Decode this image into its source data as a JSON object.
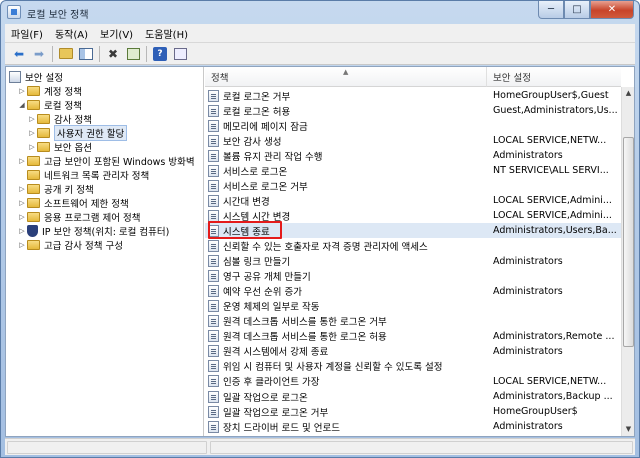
{
  "window": {
    "title": "로컬 보안 정책",
    "min_label": "─",
    "max_label": "□",
    "close_label": "✕"
  },
  "menu": [
    "파일(F)",
    "동작(A)",
    "보기(V)",
    "도움말(H)"
  ],
  "toolbar": {
    "back": "⬅",
    "forward": "➡",
    "delete": "✖",
    "help": "?"
  },
  "tree": {
    "root": "보안 설정",
    "items": [
      {
        "label": "계정 정책"
      },
      {
        "label": "로컬 정책"
      },
      {
        "label": "감사 정책"
      },
      {
        "label": "사용자 권한 할당"
      },
      {
        "label": "보안 옵션"
      },
      {
        "label": "고급 보안이 포함된 Windows 방화벽"
      },
      {
        "label": "네트워크 목록 관리자 정책"
      },
      {
        "label": "공개 키 정책"
      },
      {
        "label": "소프트웨어 제한 정책"
      },
      {
        "label": "응용 프로그램 제어 정책"
      },
      {
        "label": "IP 보안 정책(위치: 로컬 컴퓨터)"
      },
      {
        "label": "고급 감사 정책 구성"
      }
    ]
  },
  "columns": {
    "policy": "정책",
    "setting": "보안 설정"
  },
  "rows": [
    {
      "name": "로컬 로그온 거부",
      "value": "HomeGroupUser$,Guest"
    },
    {
      "name": "로컬 로그온 허용",
      "value": "Guest,Administrators,Us..."
    },
    {
      "name": "메모리에 페이지 잠금",
      "value": ""
    },
    {
      "name": "보안 감사 생성",
      "value": "LOCAL SERVICE,NETW..."
    },
    {
      "name": "볼륨 유지 관리 작업 수행",
      "value": "Administrators"
    },
    {
      "name": "서비스로 로그온",
      "value": "NT SERVICE\\ALL SERVI..."
    },
    {
      "name": "서비스로 로그온 거부",
      "value": ""
    },
    {
      "name": "시간대 변경",
      "value": "LOCAL SERVICE,Admini..."
    },
    {
      "name": "시스템 시간 변경",
      "value": "LOCAL SERVICE,Admini..."
    },
    {
      "name": "시스템 종료",
      "value": "Administrators,Users,Ba..."
    },
    {
      "name": "신뢰할 수 있는 호출자로 자격 증명 관리자에 액세스",
      "value": ""
    },
    {
      "name": "심볼 링크 만들기",
      "value": "Administrators"
    },
    {
      "name": "영구 공유 개체 만들기",
      "value": ""
    },
    {
      "name": "예약 우선 순위 증가",
      "value": "Administrators"
    },
    {
      "name": "운영 체제의 일부로 작동",
      "value": ""
    },
    {
      "name": "원격 데스크톱 서비스를 통한 로그온 거부",
      "value": ""
    },
    {
      "name": "원격 데스크톱 서비스를 통한 로그온 허용",
      "value": "Administrators,Remote ..."
    },
    {
      "name": "원격 시스템에서 강제 종료",
      "value": "Administrators"
    },
    {
      "name": "위임 시 컴퓨터 및 사용자 계정을 신뢰할 수 있도록 설정",
      "value": ""
    },
    {
      "name": "인증 후 클라이언트 가장",
      "value": "LOCAL SERVICE,NETW..."
    },
    {
      "name": "일괄 작업으로 로그온",
      "value": "Administrators,Backup ..."
    },
    {
      "name": "일괄 작업으로 로그온 거부",
      "value": "HomeGroupUser$"
    },
    {
      "name": "장치 드라이버 로드 및 언로드",
      "value": "Administrators"
    }
  ]
}
